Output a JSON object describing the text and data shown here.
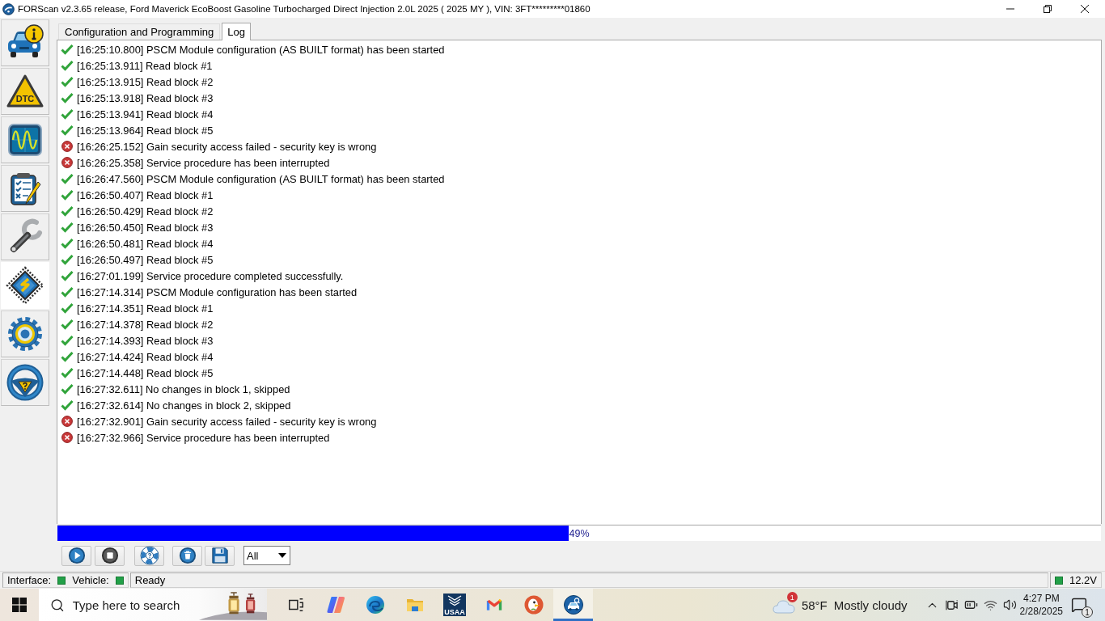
{
  "window": {
    "title": "FORScan v2.3.65 release, Ford Maverick EcoBoost Gasoline Turbocharged Direct Injection 2.0L 2025 ( 2025 MY ), VIN: 3FT*********01860"
  },
  "sidebar": {
    "items": [
      {
        "kind": "vehicle-info",
        "selected": false
      },
      {
        "kind": "dtc",
        "label": "DTC",
        "selected": false
      },
      {
        "kind": "oscilloscope",
        "selected": false
      },
      {
        "kind": "checklist",
        "selected": false
      },
      {
        "kind": "wrench",
        "selected": false
      },
      {
        "kind": "chip",
        "selected": true
      },
      {
        "kind": "gear",
        "selected": false
      },
      {
        "kind": "steering-wheel",
        "selected": false
      }
    ]
  },
  "tabs": [
    {
      "label": "Configuration and Programming",
      "selected": false
    },
    {
      "label": "Log",
      "selected": true
    }
  ],
  "log": {
    "entries": [
      {
        "kind": "ok",
        "text": "[16:25:10.800] PSCM Module configuration (AS BUILT format) has been started"
      },
      {
        "kind": "ok",
        "text": "[16:25:13.911] Read block #1"
      },
      {
        "kind": "ok",
        "text": "[16:25:13.915] Read block #2"
      },
      {
        "kind": "ok",
        "text": "[16:25:13.918] Read block #3"
      },
      {
        "kind": "ok",
        "text": "[16:25:13.941] Read block #4"
      },
      {
        "kind": "ok",
        "text": "[16:25:13.964] Read block #5"
      },
      {
        "kind": "error",
        "text": "[16:26:25.152] Gain security access failed - security key is wrong"
      },
      {
        "kind": "error",
        "text": "[16:26:25.358] Service procedure has been interrupted"
      },
      {
        "kind": "ok",
        "text": "[16:26:47.560] PSCM Module configuration (AS BUILT format) has been started"
      },
      {
        "kind": "ok",
        "text": "[16:26:50.407] Read block #1"
      },
      {
        "kind": "ok",
        "text": "[16:26:50.429] Read block #2"
      },
      {
        "kind": "ok",
        "text": "[16:26:50.450] Read block #3"
      },
      {
        "kind": "ok",
        "text": "[16:26:50.481] Read block #4"
      },
      {
        "kind": "ok",
        "text": "[16:26:50.497] Read block #5"
      },
      {
        "kind": "ok",
        "text": "[16:27:01.199] Service procedure completed successfully."
      },
      {
        "kind": "ok",
        "text": "[16:27:14.314] PSCM Module configuration has been started"
      },
      {
        "kind": "ok",
        "text": "[16:27:14.351] Read block #1"
      },
      {
        "kind": "ok",
        "text": "[16:27:14.378] Read block #2"
      },
      {
        "kind": "ok",
        "text": "[16:27:14.393] Read block #3"
      },
      {
        "kind": "ok",
        "text": "[16:27:14.424] Read block #4"
      },
      {
        "kind": "ok",
        "text": "[16:27:14.448] Read block #5"
      },
      {
        "kind": "ok",
        "text": "[16:27:32.611] No changes in block 1, skipped"
      },
      {
        "kind": "ok",
        "text": "[16:27:32.614] No changes in block 2, skipped"
      },
      {
        "kind": "error",
        "text": "[16:27:32.901] Gain security access failed - security key is wrong"
      },
      {
        "kind": "error",
        "text": "[16:27:32.966] Service procedure has been interrupted"
      }
    ]
  },
  "progress": {
    "level": 0.49,
    "reading": "49%"
  },
  "toolbar": {
    "buttons": [
      {
        "kind": "play"
      },
      {
        "kind": "stop"
      },
      {
        "kind": "help"
      },
      {
        "kind": "clear"
      },
      {
        "kind": "save"
      }
    ],
    "filter": {
      "value": "All"
    }
  },
  "status_bar": {
    "indicators": [
      {
        "label": "Interface:",
        "on": true
      },
      {
        "label": "Vehicle:",
        "on": true
      }
    ],
    "message": "Ready",
    "voltage": {
      "on": true,
      "reading": "12.2V"
    }
  },
  "taskbar": {
    "search": {
      "placeholder": "Type here to search"
    },
    "apps": [
      {
        "kind": "task-view",
        "active": false
      },
      {
        "kind": "ribbon",
        "active": false
      },
      {
        "kind": "browser",
        "active": false
      },
      {
        "kind": "folder",
        "active": false
      },
      {
        "kind": "bank",
        "label": "USAA",
        "active": false
      },
      {
        "kind": "mail",
        "active": false
      },
      {
        "kind": "duck",
        "active": false
      },
      {
        "kind": "car-scan",
        "active": true
      }
    ],
    "weather": {
      "alert_count": "1",
      "temperature": "58°F",
      "condition": "Mostly cloudy"
    },
    "clock": {
      "time": "4:27 PM",
      "date": "2/28/2025"
    },
    "notifications": {
      "count": "1"
    }
  }
}
